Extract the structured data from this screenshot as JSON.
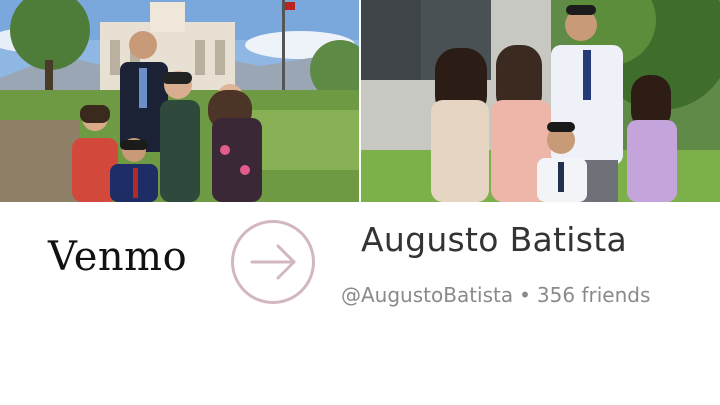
{
  "photos": {
    "left": {
      "content": "family-temple-photo"
    },
    "right": {
      "content": "family-outdoor-photo"
    }
  },
  "brand": {
    "logo_text": "Venmo"
  },
  "action": {
    "icon": "arrow-right-icon",
    "accent": "#d2b8be"
  },
  "profile": {
    "name": "Augusto Batista",
    "handle": "@AugustoBatista",
    "separator": "•",
    "friends": "356 friends"
  },
  "colors": {
    "name_text": "#333333",
    "meta_text": "#8a8a8a",
    "logo_text": "#111111"
  }
}
